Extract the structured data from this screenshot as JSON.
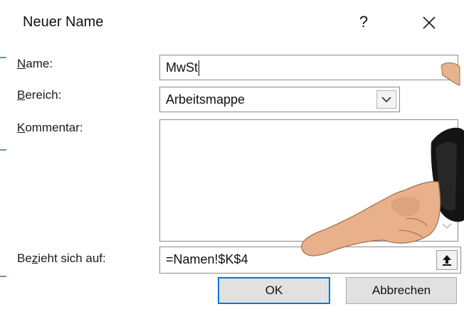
{
  "dialog": {
    "title": "Neuer Name",
    "help_label": "?",
    "close_label": "Schließen"
  },
  "form": {
    "name": {
      "label_accel": "N",
      "label_rest": "ame:",
      "value": "MwSt"
    },
    "scope": {
      "label_accel": "B",
      "label_rest": "ereich:",
      "value": "Arbeitsmappe"
    },
    "comment": {
      "label_accel": "K",
      "label_rest": "ommentar:",
      "value": ""
    },
    "refers_to": {
      "label_pre": "Be",
      "label_accel": "z",
      "label_rest": "ieht sich auf:",
      "value": "=Namen!$K$4"
    }
  },
  "buttons": {
    "ok": "OK",
    "cancel": "Abbrechen"
  },
  "colors": {
    "accent": "#0078d7",
    "button_bg": "#e1e1e1",
    "field_border": "#8a8a8a"
  },
  "icons": {
    "dropdown": "chevron-down-icon",
    "collapse": "collapse-dialog-icon",
    "close": "close-icon"
  }
}
